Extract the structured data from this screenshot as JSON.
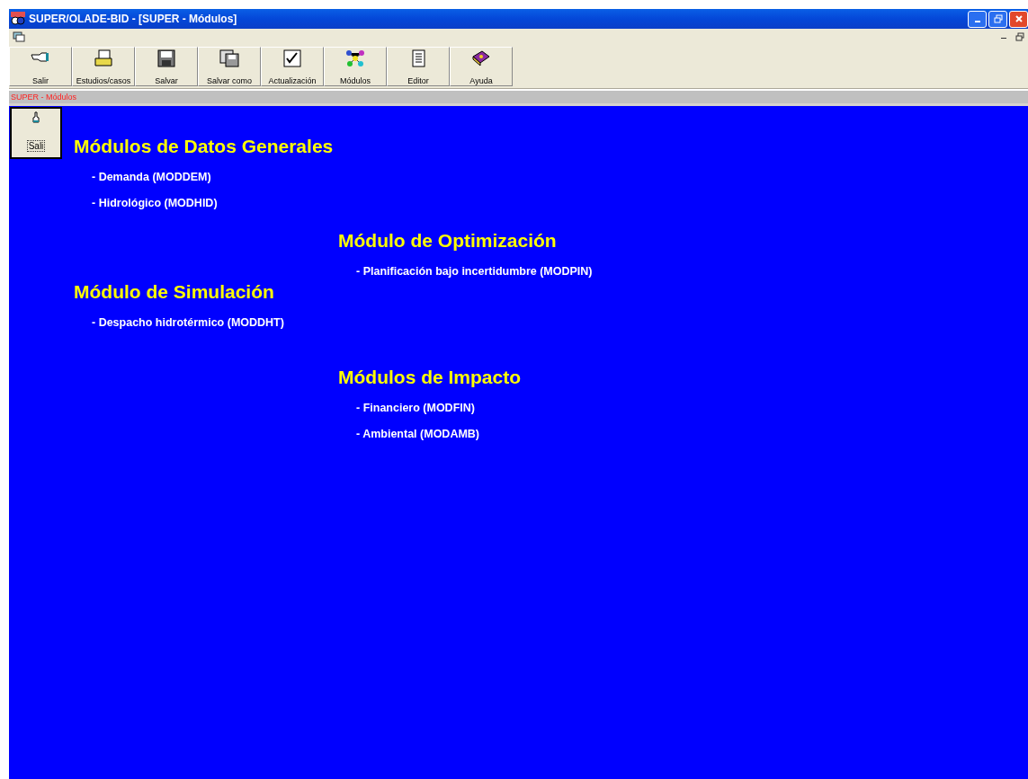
{
  "window": {
    "title": "SUPER/OLADE-BID - [SUPER - Módulos]"
  },
  "toolbar": [
    {
      "label": "Salir",
      "kind": "hand"
    },
    {
      "label": "Estudios/casos",
      "kind": "folder"
    },
    {
      "label": "Salvar",
      "kind": "disk"
    },
    {
      "label": "Salvar como",
      "kind": "disks"
    },
    {
      "label": "Actualización",
      "kind": "check"
    },
    {
      "label": "Módulos",
      "kind": "modules"
    },
    {
      "label": "Editor",
      "kind": "document"
    },
    {
      "label": "Ayuda",
      "kind": "book"
    }
  ],
  "caption": "SUPER - Módulos",
  "side_button": {
    "label": "Sali"
  },
  "sections": [
    {
      "title": "Módulos de Datos Generales",
      "items": [
        "- Demanda (MODDEM)",
        "- Hidrológico (MODHID)"
      ]
    },
    {
      "title": "Módulo de Optimización",
      "items": [
        "- Planificación bajo incertidumbre (MODPIN)"
      ]
    },
    {
      "title": "Módulo de Simulación",
      "items": [
        "- Despacho hidrotérmico (MODDHT)"
      ]
    },
    {
      "title": "Módulos de Impacto",
      "items": [
        "- Financiero (MODFIN)",
        "- Ambiental (MODAMB)"
      ]
    }
  ]
}
